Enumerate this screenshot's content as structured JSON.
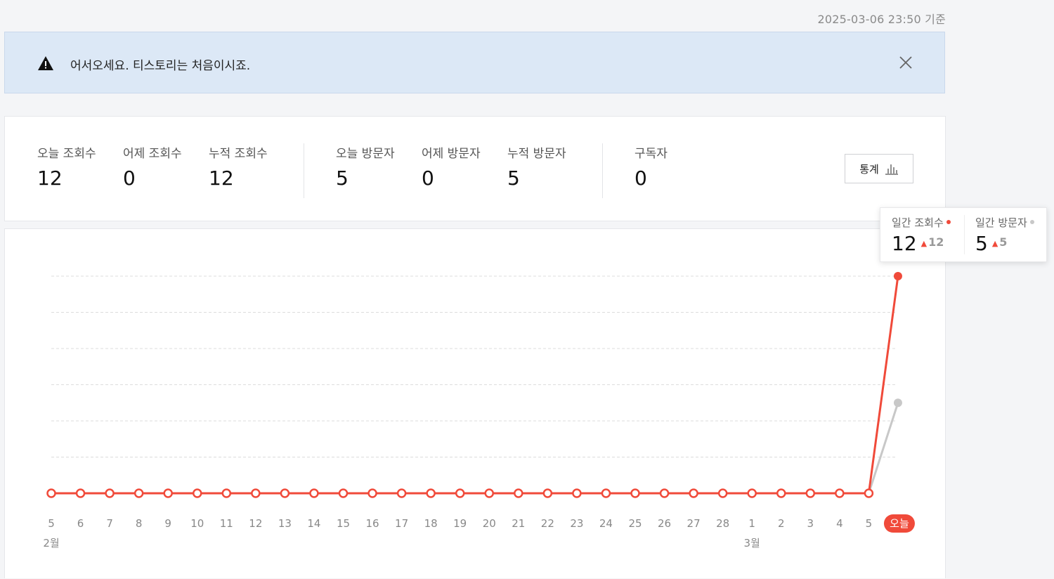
{
  "header": {
    "timestamp": "2025-03-06 23:50 기준"
  },
  "notice": {
    "message": "어서오세요. 티스토리는 처음이시죠."
  },
  "stats": {
    "today_views_label": "오늘 조회수",
    "today_views": "12",
    "yesterday_views_label": "어제 조회수",
    "yesterday_views": "0",
    "total_views_label": "누적 조회수",
    "total_views": "12",
    "today_visitors_label": "오늘 방문자",
    "today_visitors": "5",
    "yesterday_visitors_label": "어제 방문자",
    "yesterday_visitors": "0",
    "total_visitors_label": "누적 방문자",
    "total_visitors": "5",
    "subscribers_label": "구독자",
    "subscribers": "0",
    "stats_button_label": "통계"
  },
  "tooltip": {
    "views_label": "일간 조회수",
    "views_value": "12",
    "views_delta": "12",
    "visitors_label": "일간 방문자",
    "visitors_value": "5",
    "visitors_delta": "5"
  },
  "chart_data": {
    "type": "line",
    "categories": [
      "5",
      "6",
      "7",
      "8",
      "9",
      "10",
      "11",
      "12",
      "13",
      "14",
      "15",
      "16",
      "17",
      "18",
      "19",
      "20",
      "21",
      "22",
      "23",
      "24",
      "25",
      "26",
      "27",
      "28",
      "1",
      "2",
      "3",
      "4",
      "5",
      "오늘"
    ],
    "month_labels": [
      {
        "index": 0,
        "label": "2월"
      },
      {
        "index": 24,
        "label": "3월"
      }
    ],
    "today_label": "오늘",
    "series": [
      {
        "name": "일간 조회수",
        "color": "#f04a3a",
        "values": [
          0,
          0,
          0,
          0,
          0,
          0,
          0,
          0,
          0,
          0,
          0,
          0,
          0,
          0,
          0,
          0,
          0,
          0,
          0,
          0,
          0,
          0,
          0,
          0,
          0,
          0,
          0,
          0,
          0,
          12
        ]
      },
      {
        "name": "일간 방문자",
        "color": "#c8c8c8",
        "values": [
          0,
          0,
          0,
          0,
          0,
          0,
          0,
          0,
          0,
          0,
          0,
          0,
          0,
          0,
          0,
          0,
          0,
          0,
          0,
          0,
          0,
          0,
          0,
          0,
          0,
          0,
          0,
          0,
          0,
          5
        ]
      }
    ],
    "ylim": [
      0,
      12
    ],
    "grid": "dashed horizontal"
  },
  "colors": {
    "accent": "#f04a3a",
    "secondary": "#c8c8c8",
    "notice_bg": "#dce8f6"
  }
}
